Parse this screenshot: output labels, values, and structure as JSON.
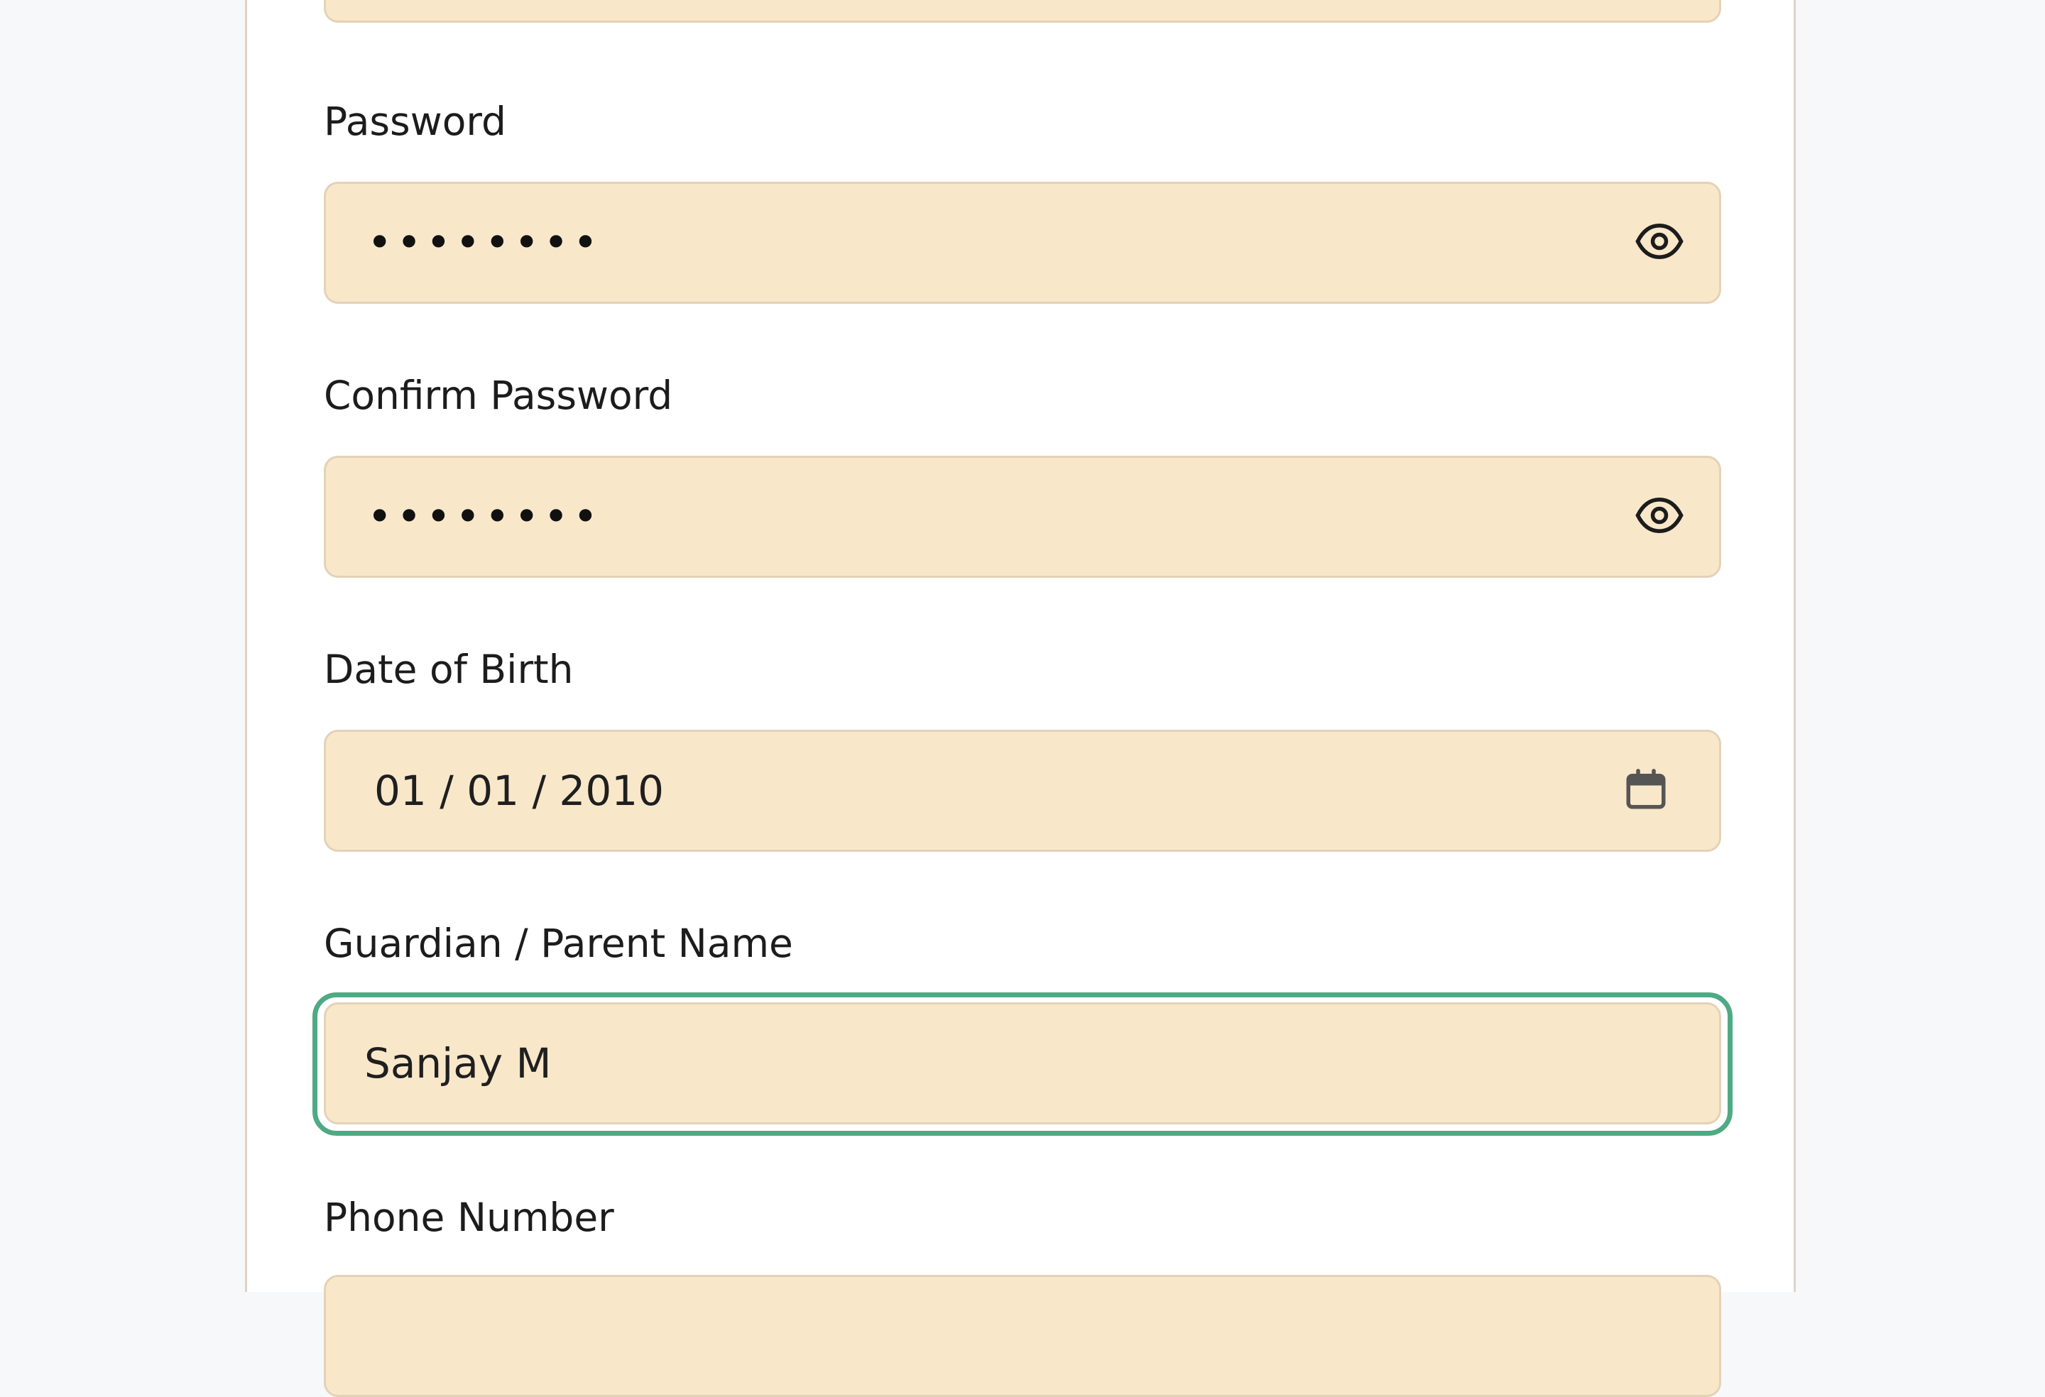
{
  "form": {
    "password": {
      "label": "Password",
      "masked_value": "••••••••",
      "toggle_icon": "eye-icon"
    },
    "confirm_password": {
      "label": "Confirm Password",
      "masked_value": "••••••••",
      "toggle_icon": "eye-icon"
    },
    "date_of_birth": {
      "label": "Date of Birth",
      "value": "01 / 01 / 2010",
      "picker_icon": "calendar-icon"
    },
    "guardian_name": {
      "label": "Guardian / Parent Name",
      "value": "Sanjay M",
      "focused": true
    },
    "phone_number": {
      "label": "Phone Number"
    }
  },
  "colors": {
    "field_background": "#f9e7ca",
    "field_border": "#e4d2b8",
    "focus_ring": "#4faa83",
    "page_background": "#f7f8fa",
    "card_background": "#ffffff"
  }
}
